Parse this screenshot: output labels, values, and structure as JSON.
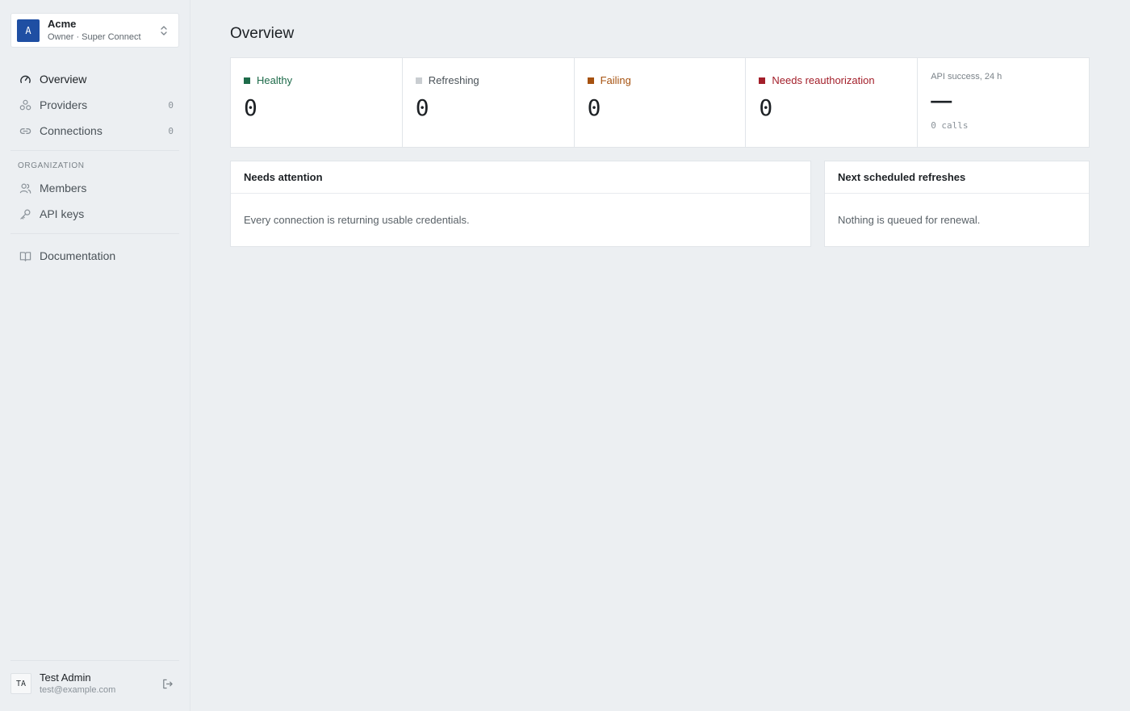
{
  "org": {
    "initial": "A",
    "name": "Acme",
    "subtitle": "Owner · Super Connect"
  },
  "nav": {
    "main": [
      {
        "label": "Overview",
        "icon": "gauge-icon",
        "count": ""
      },
      {
        "label": "Providers",
        "icon": "providers-icon",
        "count": "0"
      },
      {
        "label": "Connections",
        "icon": "link-icon",
        "count": "0"
      }
    ],
    "section_label": "Organization",
    "org_items": [
      {
        "label": "Members",
        "icon": "users-icon"
      },
      {
        "label": "API keys",
        "icon": "key-icon"
      }
    ],
    "docs": {
      "label": "Documentation",
      "icon": "book-icon"
    }
  },
  "user": {
    "initials": "TA",
    "name": "Test Admin",
    "email": "test@example.com"
  },
  "page": {
    "title": "Overview"
  },
  "stats": [
    {
      "label": "Healthy",
      "value": "0",
      "color": "#1e6b4a"
    },
    {
      "label": "Refreshing",
      "value": "0",
      "color": "#c9cdd1"
    },
    {
      "label": "Failing",
      "value": "0",
      "color": "#a65210"
    },
    {
      "label": "Needs reauthorization",
      "value": "0",
      "color": "#a31f2a"
    }
  ],
  "api": {
    "label": "API success, 24 h",
    "value": "—",
    "calls": "0 calls"
  },
  "panels": {
    "attention": {
      "title": "Needs attention",
      "body": "Every connection is returning usable credentials."
    },
    "refreshes": {
      "title": "Next scheduled refreshes",
      "body": "Nothing is queued for renewal."
    }
  },
  "colors": {
    "accent": "#1f4fa3",
    "background": "#eceff2"
  }
}
